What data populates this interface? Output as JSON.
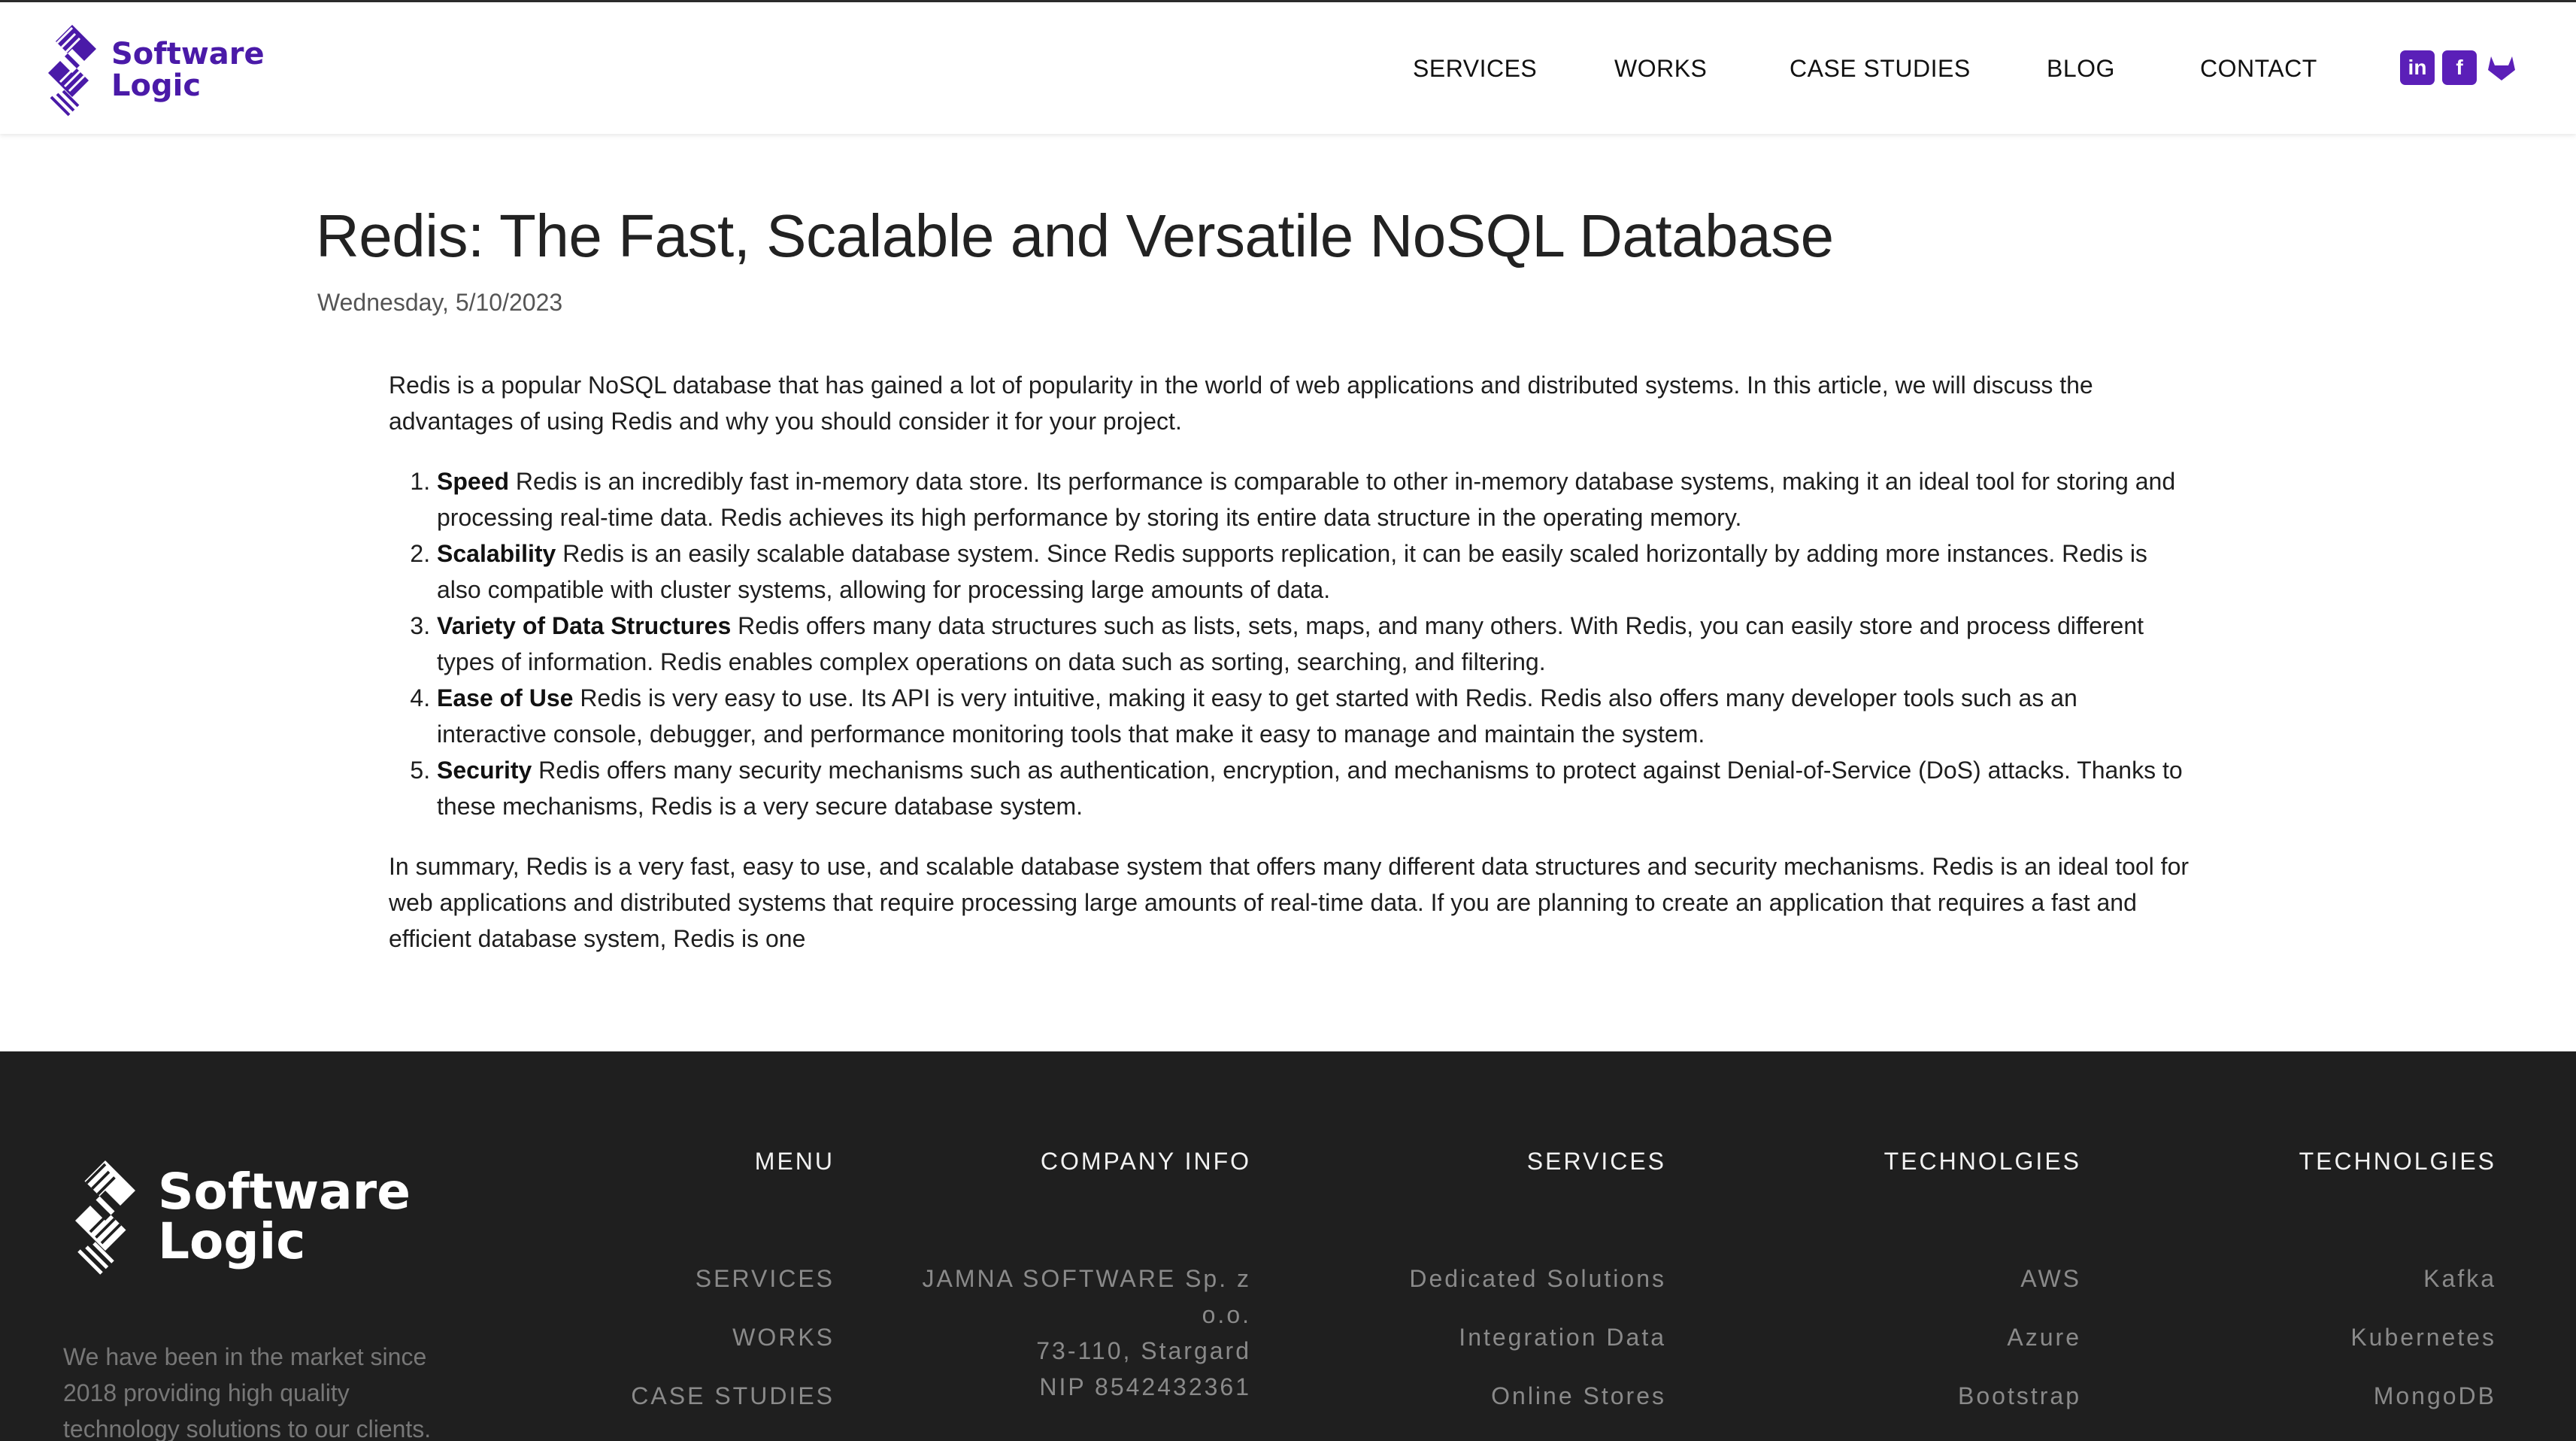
{
  "header": {
    "logo_line1": "Software",
    "logo_line2": "Logic",
    "nav": [
      "SERVICES",
      "WORKS",
      "CASE STUDIES",
      "BLOG",
      "CONTACT"
    ],
    "social_icons": [
      "linkedin-icon",
      "facebook-icon",
      "gitlab-icon"
    ],
    "brand_color": "#5b1fb8"
  },
  "article": {
    "title": "Redis: The Fast, Scalable and Versatile NoSQL Database",
    "date": "Wednesday, 5/10/2023",
    "intro": "Redis is a popular NoSQL database that has gained a lot of popularity in the world of web applications and distributed systems. In this article, we will discuss the advantages of using Redis and why you should consider it for your project.",
    "points": [
      {
        "term": "Speed",
        "text": " Redis is an incredibly fast in-memory data store. Its performance is comparable to other in-memory database systems, making it an ideal tool for storing and processing real-time data. Redis achieves its high performance by storing its entire data structure in the operating memory."
      },
      {
        "term": "Scalability",
        "text": " Redis is an easily scalable database system. Since Redis supports replication, it can be easily scaled horizontally by adding more instances. Redis is also compatible with cluster systems, allowing for processing large amounts of data."
      },
      {
        "term": "Variety of Data Structures",
        "text": " Redis offers many data structures such as lists, sets, maps, and many others. With Redis, you can easily store and process different types of information. Redis enables complex operations on data such as sorting, searching, and filtering."
      },
      {
        "term": "Ease of Use",
        "text": " Redis is very easy to use. Its API is very intuitive, making it easy to get started with Redis. Redis also offers many developer tools such as an interactive console, debugger, and performance monitoring tools that make it easy to manage and maintain the system."
      },
      {
        "term": "Security",
        "text": " Redis offers many security mechanisms such as authentication, encryption, and mechanisms to protect against Denial-of-Service (DoS) attacks. Thanks to these mechanisms, Redis is a very secure database system."
      }
    ],
    "summary": "In summary, Redis is a very fast, easy to use, and scalable database system that offers many different data structures and security mechanisms. Redis is an ideal tool for web applications and distributed systems that require processing large amounts of real-time data. If you are planning to create an application that requires a fast and efficient database system, Redis is one"
  },
  "footer": {
    "logo_line1": "Software",
    "logo_line2": "Logic",
    "about": "We have been in the market since 2018 providing high quality technology solutions to our clients.",
    "menu": {
      "heading": "MENU",
      "items": [
        "SERVICES",
        "WORKS",
        "CASE STUDIES"
      ]
    },
    "company": {
      "heading": "COMPANY INFO",
      "lines": [
        "JAMNA SOFTWARE Sp. z",
        "o.o.",
        "73-110, Stargard",
        "NIP 8542432361"
      ]
    },
    "services": {
      "heading": "SERVICES",
      "items": [
        "Dedicated Solutions",
        "Integration Data",
        "Online Stores"
      ]
    },
    "tech1": {
      "heading": "TECHNOLGIES",
      "items": [
        "AWS",
        "Azure",
        "Bootstrap"
      ]
    },
    "tech2": {
      "heading": "TECHNOLGIES",
      "items": [
        "Kafka",
        "Kubernetes",
        "MongoDB"
      ]
    }
  }
}
